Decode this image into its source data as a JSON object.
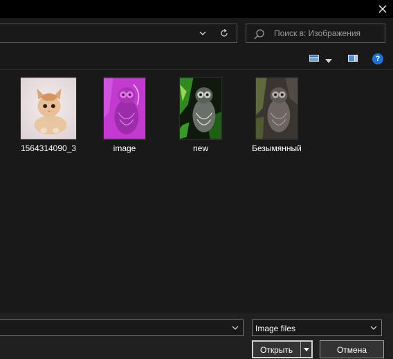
{
  "window": {
    "close_icon": "close-icon"
  },
  "address": {
    "dropdown_icon": "chevron-down-icon",
    "refresh_icon": "refresh-icon"
  },
  "search": {
    "placeholder": "Поиск в: Изображения",
    "icon": "search-icon"
  },
  "view_toolbar": {
    "change_view_icon": "view-icon",
    "more_options_icon": "chevron-down-icon",
    "preview_pane_icon": "preview-pane-icon",
    "help_icon": "help-icon",
    "help_glyph": "?"
  },
  "files": [
    {
      "name": "1564314090_3",
      "thumb": "cat"
    },
    {
      "name": "image",
      "thumb": "magenta-owl"
    },
    {
      "name": "new",
      "thumb": "green-owl"
    },
    {
      "name": "Безымянный",
      "thumb": "dark-owl"
    }
  ],
  "footer": {
    "filename_value": "",
    "filetype_value": "Image files",
    "open_label": "Открыть",
    "cancel_label": "Отмена"
  },
  "colors": {
    "background": "#191919",
    "titlebar": "#000000",
    "help_blue": "#1a73d9",
    "magenta": "#c23ad0"
  }
}
